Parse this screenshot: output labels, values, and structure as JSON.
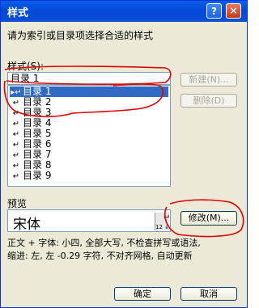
{
  "dialog": {
    "title": "样式",
    "help_glyph": "?",
    "close_glyph": "×",
    "instruction": "请为索引或目录项选择合适的样式"
  },
  "styles": {
    "label": "样式(S):",
    "input_value": "目录 1",
    "items": [
      {
        "label": "目录 1",
        "selected": true,
        "mark": "▸↵"
      },
      {
        "label": "目录 2",
        "selected": false,
        "mark": "↵"
      },
      {
        "label": "目录 3",
        "selected": false,
        "mark": "↵"
      },
      {
        "label": "目录 4",
        "selected": false,
        "mark": "↵"
      },
      {
        "label": "目录 5",
        "selected": false,
        "mark": "↵"
      },
      {
        "label": "目录 6",
        "selected": false,
        "mark": "↵"
      },
      {
        "label": "目录 7",
        "selected": false,
        "mark": "↵"
      },
      {
        "label": "目录 8",
        "selected": false,
        "mark": "↵"
      },
      {
        "label": "目录 9",
        "selected": false,
        "mark": "↵"
      }
    ]
  },
  "buttons": {
    "new": "新建(N)...",
    "delete": "删除(D)",
    "modify": "修改(M)...",
    "ok": "确定",
    "cancel": "取消"
  },
  "preview": {
    "label": "预览",
    "font_sample": "宋体",
    "size_indicator": "12 ↓",
    "paragraph_mark": "↵"
  },
  "description": {
    "line1": "正文 + 字体: 小四, 全部大写, 不检查拼写或语法,",
    "line2": "缩进: 左, 左  -0.29 字符, 不对齐网格, 自动更新"
  },
  "colors": {
    "titlebar": "#0348d6",
    "selection": "#316ac5",
    "dialog_bg": "#ece9d8",
    "annotation": "#e00000"
  }
}
